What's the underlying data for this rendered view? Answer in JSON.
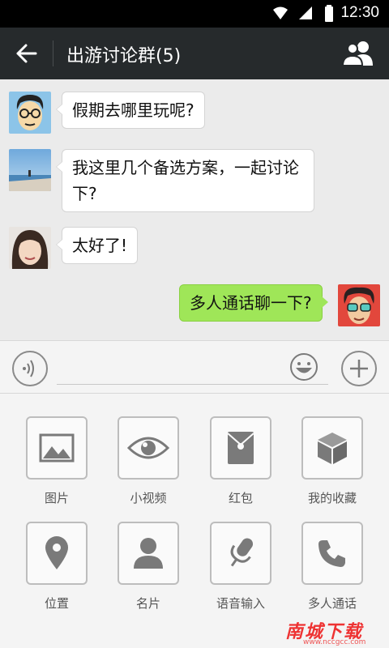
{
  "status_bar": {
    "time": "12:30"
  },
  "header": {
    "title": "出游讨论群(5)"
  },
  "messages": [
    {
      "sender": "left",
      "text": "假期去哪里玩呢?"
    },
    {
      "sender": "left",
      "text": "我这里几个备选方案，一起讨论下?"
    },
    {
      "sender": "left",
      "text": "太好了!"
    },
    {
      "sender": "right",
      "text": "多人通话聊一下?"
    }
  ],
  "input": {
    "value": "",
    "placeholder": ""
  },
  "tools": [
    {
      "label": "图片",
      "icon": "image-icon"
    },
    {
      "label": "小视频",
      "icon": "eye-icon"
    },
    {
      "label": "红包",
      "icon": "red-packet-icon"
    },
    {
      "label": "我的收藏",
      "icon": "box-icon"
    },
    {
      "label": "位置",
      "icon": "location-pin-icon"
    },
    {
      "label": "名片",
      "icon": "person-icon"
    },
    {
      "label": "语音输入",
      "icon": "microphone-icon"
    },
    {
      "label": "多人通话",
      "icon": "phone-icon"
    }
  ],
  "watermark": {
    "brand": "南城下载",
    "url": "www.nccgcc.com"
  }
}
